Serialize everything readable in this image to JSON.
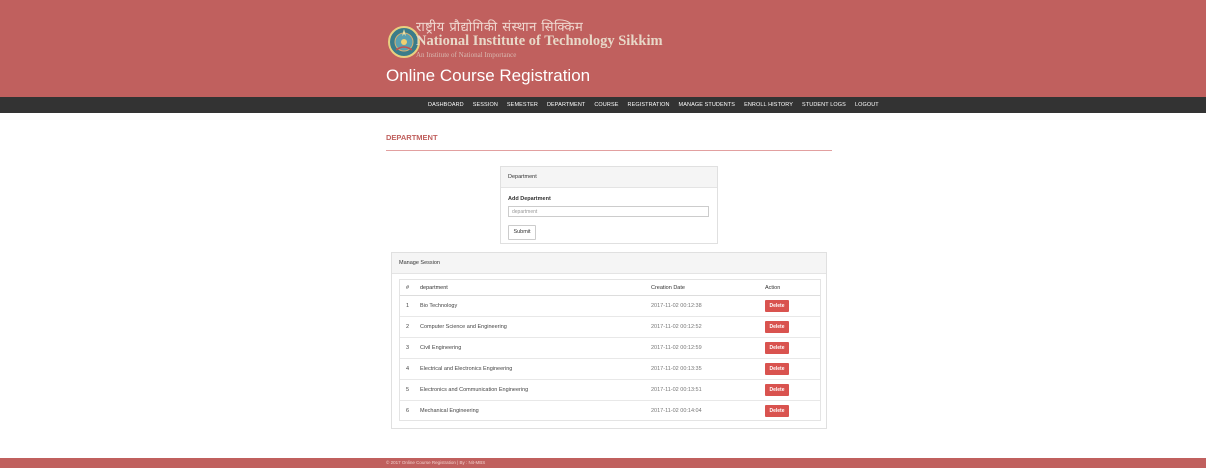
{
  "header": {
    "hindi_name": "राष्ट्रीय प्रौद्योगिकी संस्थान सिक्किम",
    "institute_name": "National Institute of Technology Sikkim",
    "institute_sub": "An Institute of National Importance",
    "app_title": "Online Course Registration",
    "header_color": "#c0605e"
  },
  "nav": {
    "items": [
      "DASHBOARD",
      "SESSION",
      "SEMESTER",
      "DEPARTMENT",
      "COURSE",
      "REGISTRATION",
      "MANAGE STUDENTS",
      "ENROLL HISTORY",
      "STUDENT LOGS",
      "LOGOUT"
    ]
  },
  "page": {
    "heading": "DEPARTMENT"
  },
  "form": {
    "panel_title": "Department",
    "label": "Add Department",
    "placeholder": "department",
    "submit_label": "Submit"
  },
  "table": {
    "panel_title": "Manage Session",
    "columns": [
      "#",
      "department",
      "Creation Date",
      "Action"
    ],
    "rows": [
      {
        "num": "1",
        "department": "Bio Technology",
        "date": "2017-11-02 00:12:38",
        "action": "Delete"
      },
      {
        "num": "2",
        "department": "Computer Science and Engineering",
        "date": "2017-11-02 00:12:52",
        "action": "Delete"
      },
      {
        "num": "3",
        "department": "Civil Engineering",
        "date": "2017-11-02 00:12:59",
        "action": "Delete"
      },
      {
        "num": "4",
        "department": "Electrical and Electronics Engineering",
        "date": "2017-11-02 00:13:35",
        "action": "Delete"
      },
      {
        "num": "5",
        "department": "Electronics and Communication Engineering",
        "date": "2017-11-02 00:13:51",
        "action": "Delete"
      },
      {
        "num": "6",
        "department": "Mechanical Engineering",
        "date": "2017-11-02 00:14:04",
        "action": "Delete"
      }
    ],
    "delete_color": "#d9534f"
  },
  "footer": {
    "text": "© 2017 Online Course Registration | By : Nit-MBS"
  }
}
